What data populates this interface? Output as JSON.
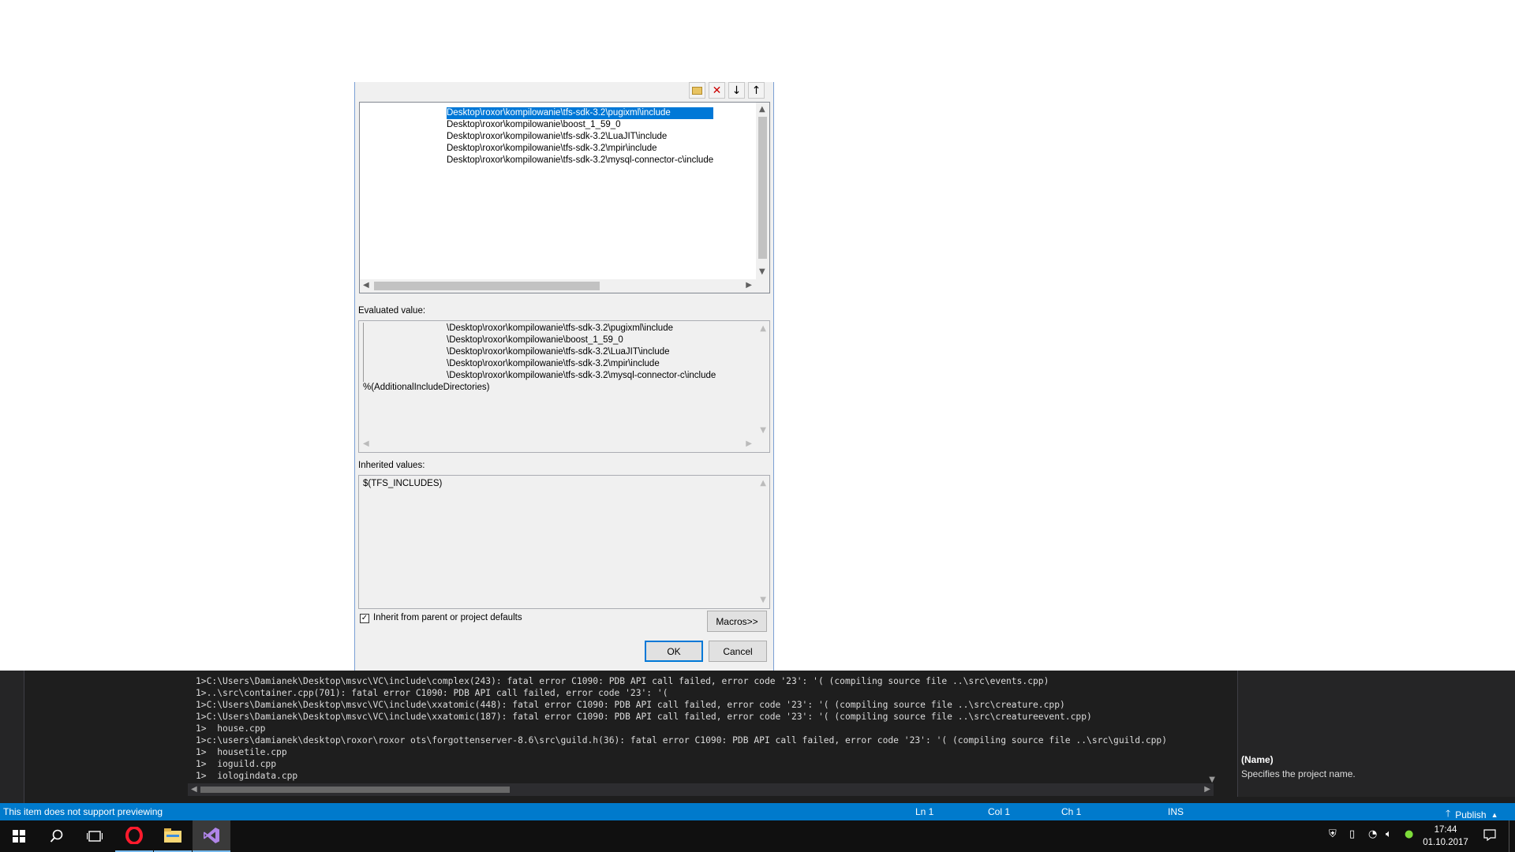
{
  "dialog": {
    "toolbar": {
      "new_line_icon": "folder-new-icon",
      "delete_icon": "delete-icon",
      "move_down_icon": "arrow-down-icon",
      "move_up_icon": "arrow-up-icon"
    },
    "entries": [
      "Desktop\\roxor\\kompilowanie\\tfs-sdk-3.2\\pugixml\\include",
      "Desktop\\roxor\\kompilowanie\\boost_1_59_0",
      "Desktop\\roxor\\kompilowanie\\tfs-sdk-3.2\\LuaJIT\\include",
      "Desktop\\roxor\\kompilowanie\\tfs-sdk-3.2\\mpir\\include",
      "Desktop\\roxor\\kompilowanie\\tfs-sdk-3.2\\mysql-connector-c\\include"
    ],
    "evaluated_label": "Evaluated value:",
    "evaluated": [
      "\\Desktop\\roxor\\kompilowanie\\tfs-sdk-3.2\\pugixml\\include",
      "\\Desktop\\roxor\\kompilowanie\\boost_1_59_0",
      "\\Desktop\\roxor\\kompilowanie\\tfs-sdk-3.2\\LuaJIT\\include",
      "\\Desktop\\roxor\\kompilowanie\\tfs-sdk-3.2\\mpir\\include",
      "\\Desktop\\roxor\\kompilowanie\\tfs-sdk-3.2\\mysql-connector-c\\include",
      "%(AdditionalIncludeDirectories)"
    ],
    "inherited_label": "Inherited values:",
    "inherited": [
      "$(TFS_INCLUDES)"
    ],
    "inherit_checkbox": {
      "label": "Inherit from parent or project defaults",
      "checked": true
    },
    "macros_button": "Macros>>",
    "ok_button": "OK",
    "cancel_button": "Cancel"
  },
  "output": {
    "lines": [
      "1>C:\\Users\\Damianek\\Desktop\\msvc\\VC\\include\\complex(243): fatal error C1090: PDB API call failed, error code '23': '( (compiling source file ..\\src\\events.cpp)",
      "1>..\\src\\container.cpp(701): fatal error C1090: PDB API call failed, error code '23': '(",
      "1>C:\\Users\\Damianek\\Desktop\\msvc\\VC\\include\\xxatomic(448): fatal error C1090: PDB API call failed, error code '23': '( (compiling source file ..\\src\\creature.cpp)",
      "1>C:\\Users\\Damianek\\Desktop\\msvc\\VC\\include\\xxatomic(187): fatal error C1090: PDB API call failed, error code '23': '( (compiling source file ..\\src\\creatureevent.cpp)",
      "1>  house.cpp",
      "1>c:\\users\\damianek\\desktop\\roxor\\roxor ots\\forgottenserver-8.6\\src\\guild.h(36): fatal error C1090: PDB API call failed, error code '23': '( (compiling source file ..\\src\\guild.cpp)",
      "1>  housetile.cpp",
      "1>  ioguild.cpp",
      "1>  iologindata.cpp"
    ]
  },
  "properties": {
    "name_title": "(Name)",
    "name_desc": "Specifies the project name."
  },
  "statusbar": {
    "message": "This item does not support previewing",
    "ln": "Ln 1",
    "col": "Col 1",
    "ch": "Ch 1",
    "ins": "INS",
    "publish": "Publish"
  },
  "taskbar": {
    "icons": [
      "windows-start-icon",
      "search-icon",
      "task-view-icon",
      "opera-icon",
      "file-explorer-icon",
      "visual-studio-icon"
    ],
    "time": "17:44",
    "date": "01.10.2017"
  },
  "colors": {
    "statusbar": "#007acc",
    "selection": "#0078d7",
    "output_bg": "#1e1e1e",
    "taskbar": "#101010"
  }
}
